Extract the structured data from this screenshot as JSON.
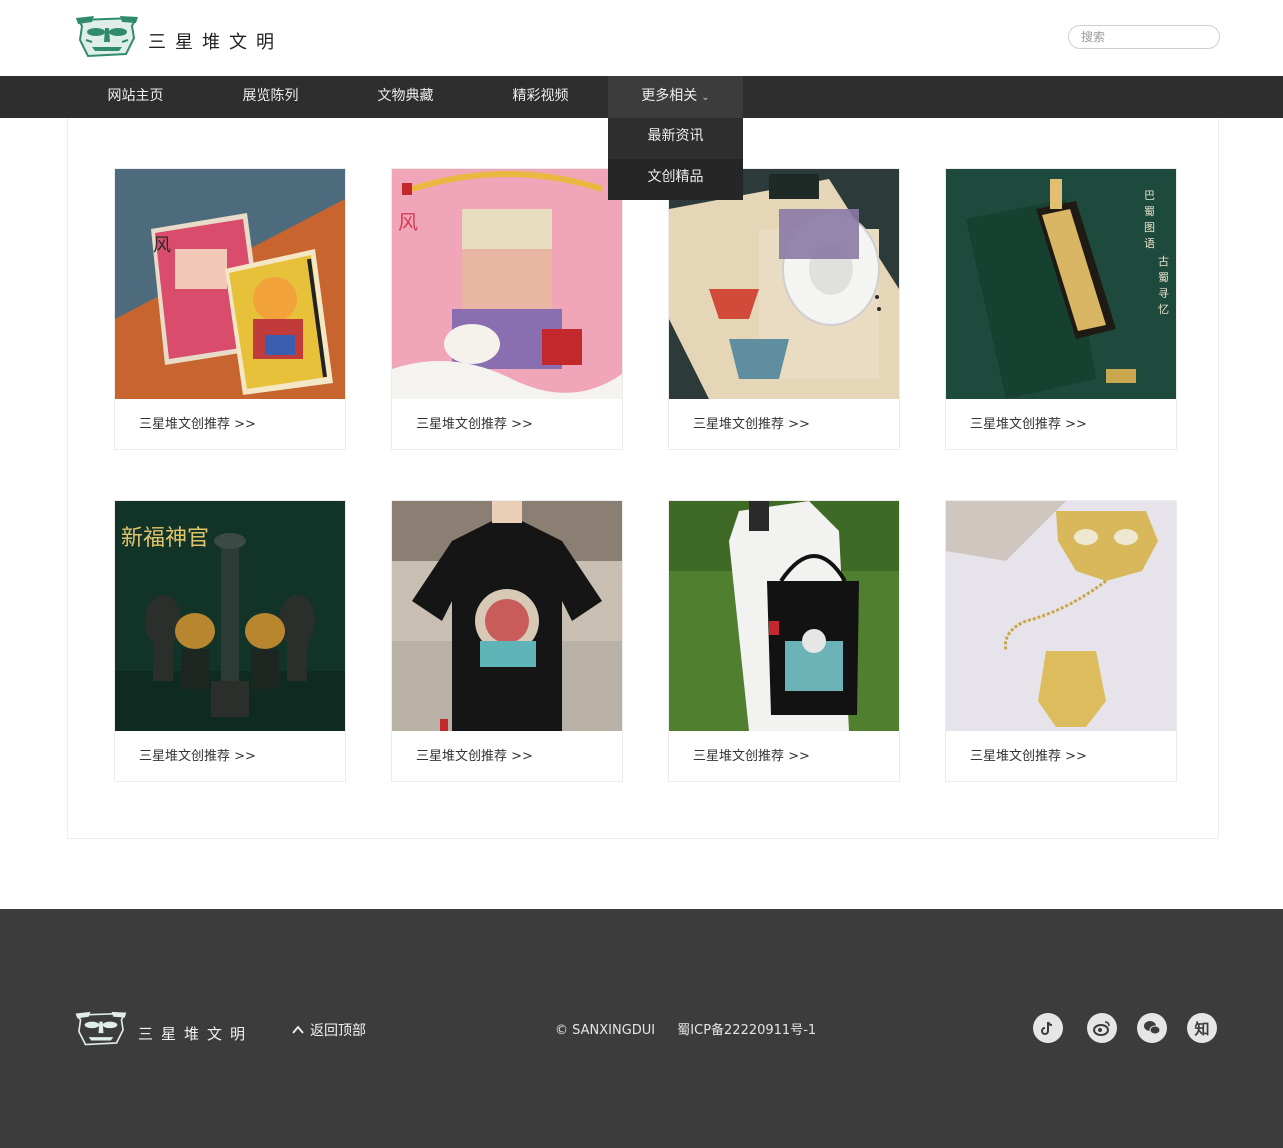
{
  "header": {
    "logo_text": "三星堆文明",
    "search_placeholder": "搜索"
  },
  "nav": {
    "items": [
      {
        "label": "网站主页"
      },
      {
        "label": "展览陈列"
      },
      {
        "label": "文物典藏"
      },
      {
        "label": "精彩视频"
      },
      {
        "label": "更多相关"
      }
    ],
    "dropdown": [
      {
        "label": "最新资讯"
      },
      {
        "label": "文创精品"
      }
    ]
  },
  "cards": [
    {
      "caption": "三星堆文创推荐 >>",
      "image": "notebook-illustrated"
    },
    {
      "caption": "三星堆文创推荐 >>",
      "image": "illustrated-poster"
    },
    {
      "caption": "三星堆文创推荐 >>",
      "image": "washi-tape-notebook"
    },
    {
      "caption": "三星堆文创推荐 >>",
      "image": "bookmark-green"
    },
    {
      "caption": "三星堆文创推荐 >>",
      "image": "bronze-figurines"
    },
    {
      "caption": "三星堆文创推荐 >>",
      "image": "black-tshirt"
    },
    {
      "caption": "三星堆文创推荐 >>",
      "image": "tote-bag"
    },
    {
      "caption": "三星堆文创推荐 >>",
      "image": "gold-bookmark"
    }
  ],
  "footer": {
    "logo_text": "三星堆文明",
    "back_to_top": "返回顶部",
    "copyright": "© SANXINGDUI",
    "icp": "蜀ICP备22220911号-1",
    "social": [
      {
        "icon": "douyin-icon"
      },
      {
        "icon": "weibo-icon"
      },
      {
        "icon": "wechat-icon"
      },
      {
        "icon": "zhihu-icon",
        "label": "知"
      }
    ]
  },
  "colors": {
    "nav_bg": "#2e2e2e",
    "footer_bg": "#3c3c3c",
    "logo_green": "#2f8a6e"
  }
}
